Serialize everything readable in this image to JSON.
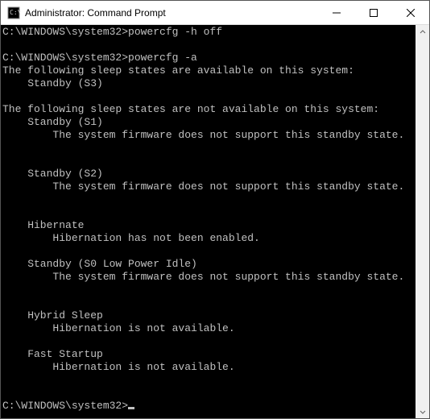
{
  "window": {
    "title": "Administrator: Command Prompt"
  },
  "terminal": {
    "lines": [
      {
        "indent": 0,
        "text": "C:\\WINDOWS\\system32>powercfg -h off"
      },
      {
        "indent": 0,
        "text": ""
      },
      {
        "indent": 0,
        "text": "C:\\WINDOWS\\system32>powercfg -a"
      },
      {
        "indent": 0,
        "text": "The following sleep states are available on this system:"
      },
      {
        "indent": 1,
        "text": "Standby (S3)"
      },
      {
        "indent": 0,
        "text": ""
      },
      {
        "indent": 0,
        "text": "The following sleep states are not available on this system:"
      },
      {
        "indent": 1,
        "text": "Standby (S1)"
      },
      {
        "indent": 2,
        "text": "The system firmware does not support this standby state."
      },
      {
        "indent": 0,
        "text": ""
      },
      {
        "indent": 0,
        "text": ""
      },
      {
        "indent": 1,
        "text": "Standby (S2)"
      },
      {
        "indent": 2,
        "text": "The system firmware does not support this standby state."
      },
      {
        "indent": 0,
        "text": ""
      },
      {
        "indent": 0,
        "text": ""
      },
      {
        "indent": 1,
        "text": "Hibernate"
      },
      {
        "indent": 2,
        "text": "Hibernation has not been enabled."
      },
      {
        "indent": 0,
        "text": ""
      },
      {
        "indent": 1,
        "text": "Standby (S0 Low Power Idle)"
      },
      {
        "indent": 2,
        "text": "The system firmware does not support this standby state."
      },
      {
        "indent": 0,
        "text": ""
      },
      {
        "indent": 0,
        "text": ""
      },
      {
        "indent": 1,
        "text": "Hybrid Sleep"
      },
      {
        "indent": 2,
        "text": "Hibernation is not available."
      },
      {
        "indent": 0,
        "text": ""
      },
      {
        "indent": 1,
        "text": "Fast Startup"
      },
      {
        "indent": 2,
        "text": "Hibernation is not available."
      },
      {
        "indent": 0,
        "text": ""
      },
      {
        "indent": 0,
        "text": ""
      }
    ],
    "prompt": "C:\\WINDOWS\\system32>",
    "indentUnit": "    "
  }
}
